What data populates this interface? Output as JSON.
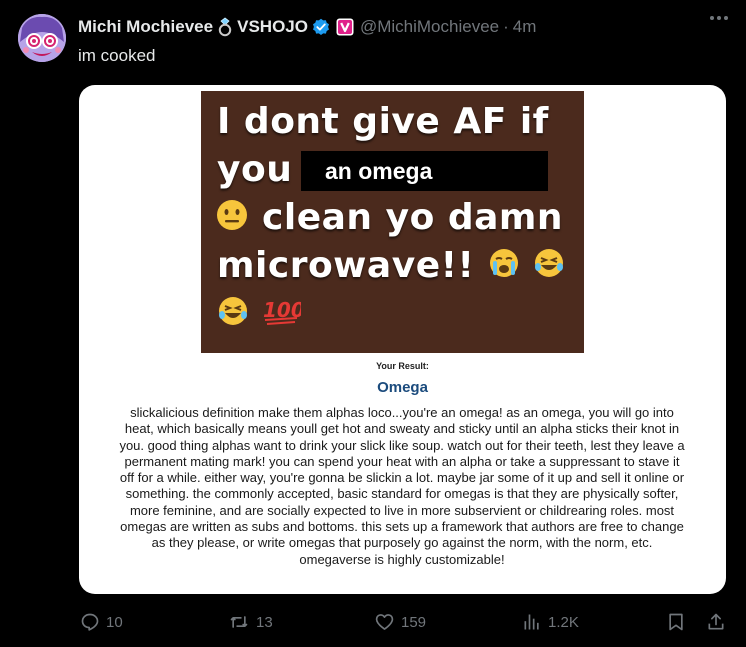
{
  "tweet": {
    "display_name": "Michi Mochievee",
    "org": "VSHOJO",
    "handle": "@MichiMochievee",
    "separator": "·",
    "time": "4m",
    "text": "im cooked"
  },
  "meme": {
    "line1": "I dont give AF if",
    "line2": "you",
    "blackbox": "an omega",
    "line3": "clean yo damn",
    "line4": "microwave!!"
  },
  "result": {
    "label": "Your Result:",
    "title": "Omega",
    "body": "slickalicious definition make them alphas loco...you're an omega! as an omega, you will go into heat, which basically means youll get hot and sweaty and sticky until an alpha sticks their knot in you. good thing alphas want to drink your slick like soup. watch out for their teeth, lest they leave a permanent mating mark! you can spend your heat with an alpha or take a suppressant to stave it off for a while. either way, you're gonna be slickin a lot. maybe jar some of it up and sell it online or something. the commonly accepted, basic standard for omegas is that they are physically softer, more feminine, and are socially expected to live in more subservient or childrearing roles. most omegas are written as subs and bottoms. this sets up a framework that authors are free to change as they please, or write omegas that purposely go against the norm, with the norm, etc. omegaverse is highly customizable!"
  },
  "actions": {
    "replies": "10",
    "reposts": "13",
    "likes": "159",
    "views": "1.2K"
  },
  "icons": [
    "ring-icon",
    "verified-icon",
    "affiliate-badge-icon",
    "more-icon",
    "reply-icon",
    "repost-icon",
    "like-icon",
    "views-icon",
    "bookmark-icon",
    "share-icon"
  ],
  "colors": {
    "background": "#000000",
    "verified": "#1d9bf0",
    "affiliate_badge": "#e0218a",
    "muted": "#71767b"
  }
}
